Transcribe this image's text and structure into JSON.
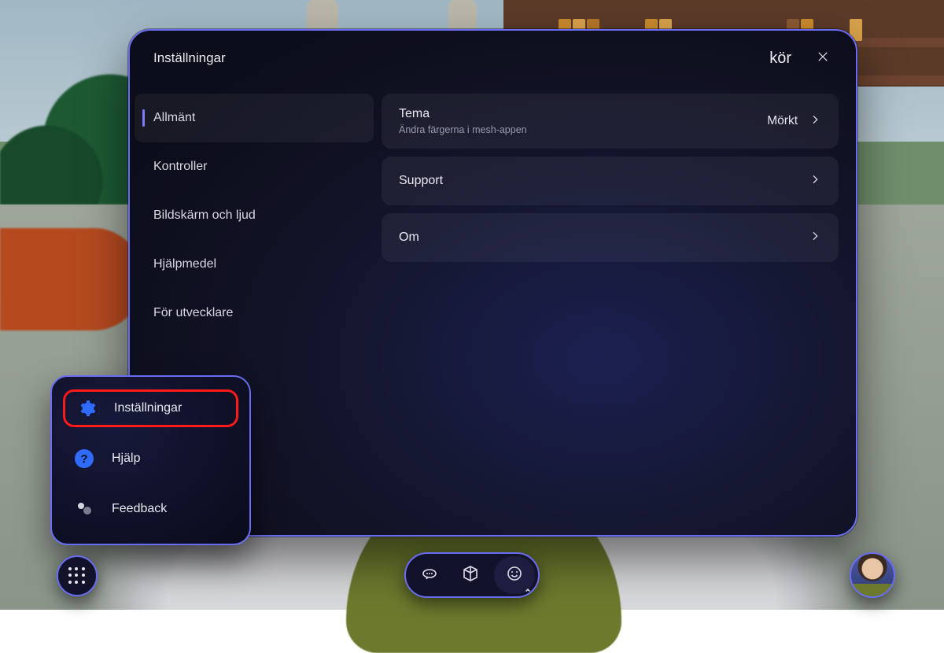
{
  "window": {
    "title": "Inställningar",
    "run_label": "kör"
  },
  "sidebar": {
    "items": [
      {
        "label": "Allmänt",
        "active": true
      },
      {
        "label": "Kontroller",
        "active": false
      },
      {
        "label": "Bildskärm och ljud",
        "active": false
      },
      {
        "label": "Hjälpmedel",
        "active": false
      },
      {
        "label": "För utvecklare",
        "active": false
      }
    ]
  },
  "rows": [
    {
      "title": "Tema",
      "subtitle": "Ändra färgerna i mesh-appen",
      "value": "Mörkt"
    },
    {
      "title": "Support",
      "subtitle": "",
      "value": ""
    },
    {
      "title": "Om",
      "subtitle": "",
      "value": ""
    }
  ],
  "popup": {
    "items": [
      {
        "label": "Inställningar"
      },
      {
        "label": "Hjälp"
      },
      {
        "label": "Feedback"
      }
    ]
  }
}
